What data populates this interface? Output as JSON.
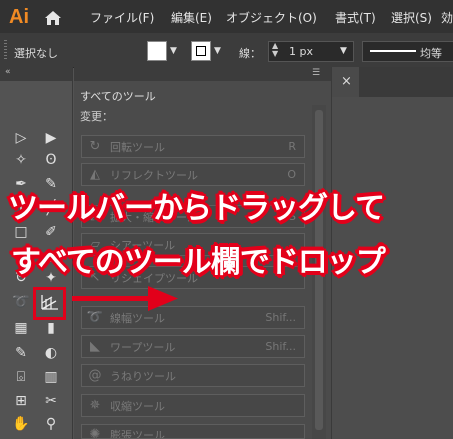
{
  "app": {
    "logo_text": "Ai",
    "accent": "#f08a24"
  },
  "menu": [
    "ファイル(F)",
    "編集(E)",
    "オブジェクト(O)",
    "書式(T)",
    "選択(S)",
    "効"
  ],
  "control_bar": {
    "selection_label": "選択なし",
    "fill_color": "#ffffff",
    "stroke_label": "線：",
    "stroke_value": "1 px",
    "profile_label": "均等"
  },
  "panel": {
    "title": "すべてのツール",
    "group_label": "変更：",
    "rows": [
      {
        "icon": "rotate-icon",
        "label": "回転ツール",
        "key": "R"
      },
      {
        "icon": "reflect-icon",
        "label": "リフレクトツール",
        "key": "O"
      },
      {
        "icon": "scale-icon",
        "label": "拡大・縮小ツール",
        "key": "S"
      },
      {
        "icon": "shear-icon",
        "label": "シアーツール",
        "key": ""
      },
      {
        "icon": "reshape-icon",
        "label": "リシェイプツール",
        "key": ""
      },
      {
        "icon": "width-icon",
        "label": "線幅ツール",
        "key": "Shif..."
      },
      {
        "icon": "warp-icon",
        "label": "ワープツール",
        "key": "Shif..."
      },
      {
        "icon": "twirl-icon",
        "label": "うねりツール",
        "key": ""
      },
      {
        "icon": "pucker-icon",
        "label": "収縮ツール",
        "key": ""
      },
      {
        "icon": "bloat-icon",
        "label": "膨張ツール",
        "key": ""
      }
    ]
  },
  "document": {
    "close_glyph": "×"
  },
  "annotations": {
    "caption_line1": "ツールバーからドラッグして",
    "caption_line2": "すべてのツール欄でドロップ",
    "highlight_color": "#e2001a"
  }
}
